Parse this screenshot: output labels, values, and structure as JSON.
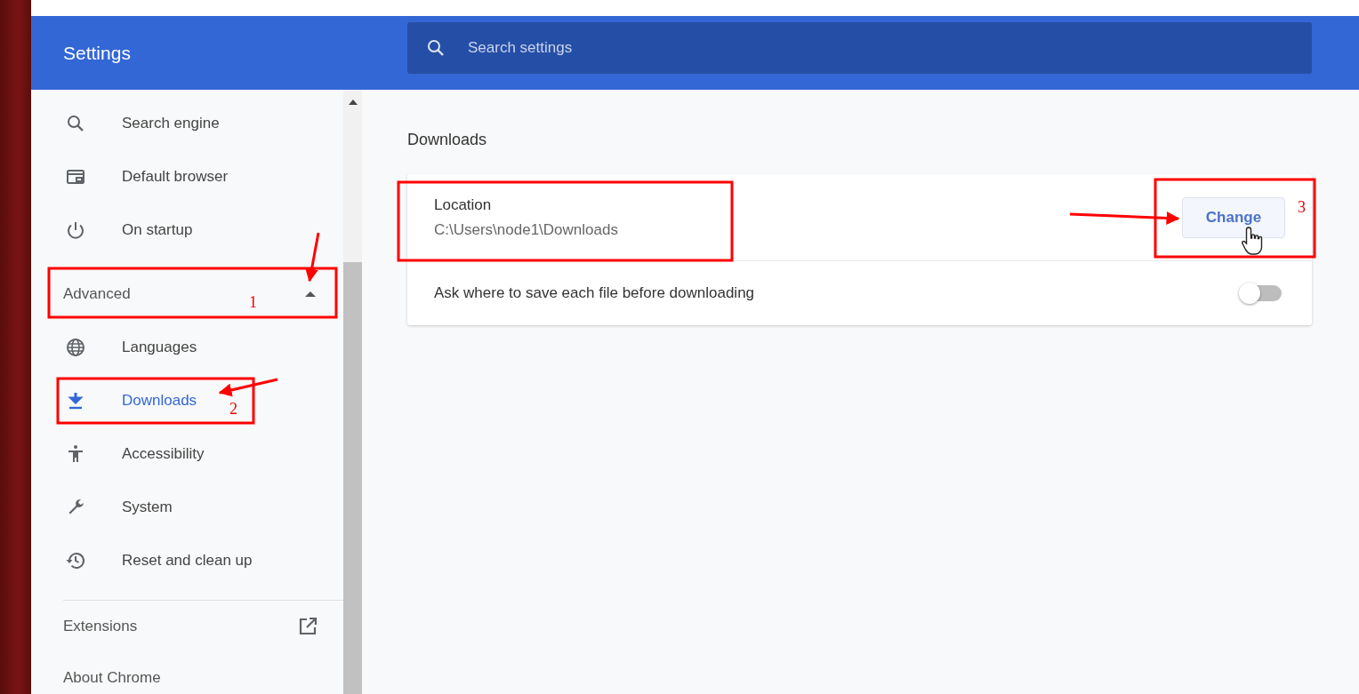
{
  "header": {
    "title": "Settings",
    "search": {
      "placeholder": "Search settings"
    }
  },
  "sidebar": {
    "items": [
      {
        "label": "Search engine",
        "selected": false
      },
      {
        "label": "Default browser",
        "selected": false
      },
      {
        "label": "On startup",
        "selected": false
      }
    ],
    "advanced": {
      "label": "Advanced",
      "expanded": true,
      "items": [
        {
          "label": "Languages",
          "selected": false
        },
        {
          "label": "Downloads",
          "selected": true
        },
        {
          "label": "Accessibility",
          "selected": false
        },
        {
          "label": "System",
          "selected": false
        },
        {
          "label": "Reset and clean up",
          "selected": false
        }
      ]
    },
    "footer": [
      {
        "label": "Extensions"
      },
      {
        "label": "About Chrome"
      }
    ]
  },
  "main": {
    "section_title": "Downloads",
    "location": {
      "label": "Location",
      "path": "C:\\Users\\node1\\Downloads",
      "button": "Change"
    },
    "ask_toggle": {
      "label": "Ask where to save each file before downloading",
      "on": false
    }
  },
  "annotations": [
    {
      "label": "1"
    },
    {
      "label": "2"
    },
    {
      "label": "3"
    }
  ]
}
